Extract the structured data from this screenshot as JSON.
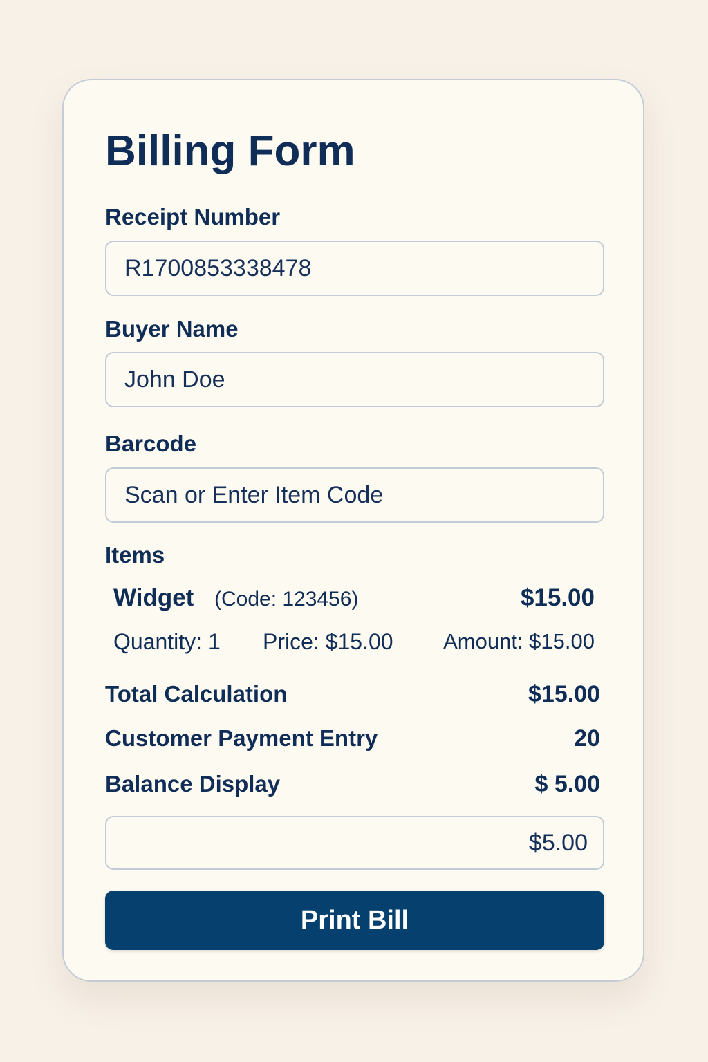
{
  "form": {
    "title": "Billing Form",
    "receipt": {
      "label": "Receipt Number",
      "value": "R1700853338478"
    },
    "buyer": {
      "label": "Buyer Name",
      "value": "John Doe"
    },
    "barcode": {
      "label": "Barcode",
      "placeholder": "Scan or Enter Item Code"
    },
    "items": {
      "label": "Items",
      "list": [
        {
          "name": "Widget",
          "code": "(Code: 123456)",
          "price_total": "$15.00",
          "quantity": "Quantity: 1",
          "price": "Price: $15.00",
          "amount": "Amount: $15.00"
        }
      ]
    },
    "summary": {
      "total_label": "Total Calculation",
      "total_value": "$15.00",
      "payment_label": "Customer Payment Entry",
      "payment_value": "20",
      "balance_label": "Balance Display",
      "balance_value": "$ 5.00",
      "balance_field_value": "$5.00"
    },
    "print_label": "Print Bill"
  },
  "colors": {
    "page_background": "#f8f1e8",
    "card_background": "#fdfaf1",
    "text": "#0f2d57",
    "button": "#05406e",
    "border": "#c5ccd6"
  }
}
